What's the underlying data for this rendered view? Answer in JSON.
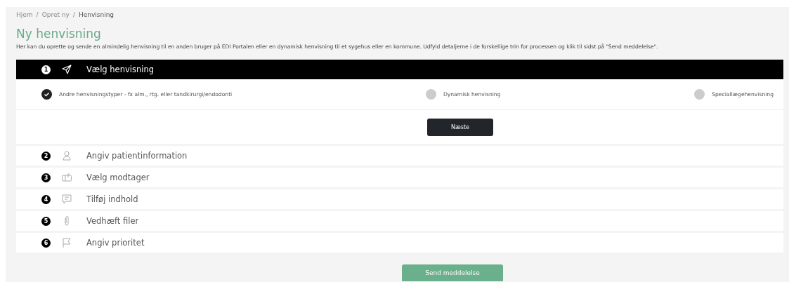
{
  "breadcrumb": [
    {
      "label": "Hjem",
      "current": false
    },
    {
      "label": "Opret ny",
      "current": false
    },
    {
      "label": "Henvisning",
      "current": true
    }
  ],
  "breadcrumb_separator": "/",
  "title": "Ny henvisning",
  "description": "Her kan du oprette og sende en almindelig henvisning til en anden bruger på EDI Portalen eller en dynamisk henvisning til et sygehus eller en kommune. Udfyld detaljerne i de forskellige trin for processen og klik til sidst på \"Send meddelelse\".",
  "steps": [
    {
      "number": "1",
      "kind": "send",
      "label": "Vælg henvisning",
      "expanded": true,
      "options": [
        {
          "label": "Andre henvisningstyper - fx alm., rtg. eller tandkirurgi/endodonti",
          "selected": true
        },
        {
          "label": "Dynamisk henvisning",
          "selected": false
        },
        {
          "label": "Speciallægehenvisning",
          "selected": false
        }
      ],
      "next_button": "Næste"
    },
    {
      "number": "2",
      "kind": "person",
      "label": "Angiv patientinformation",
      "expanded": false
    },
    {
      "number": "3",
      "kind": "recipient",
      "label": "Vælg modtager",
      "expanded": false
    },
    {
      "number": "4",
      "kind": "content",
      "label": "Tilføj indhold",
      "expanded": false
    },
    {
      "number": "5",
      "kind": "attachment",
      "label": "Vedhæft filer",
      "expanded": false
    },
    {
      "number": "6",
      "kind": "priority",
      "label": "Angiv prioritet",
      "expanded": false
    }
  ],
  "send_button": {
    "label": "Send meddelelse",
    "disabled": true
  }
}
